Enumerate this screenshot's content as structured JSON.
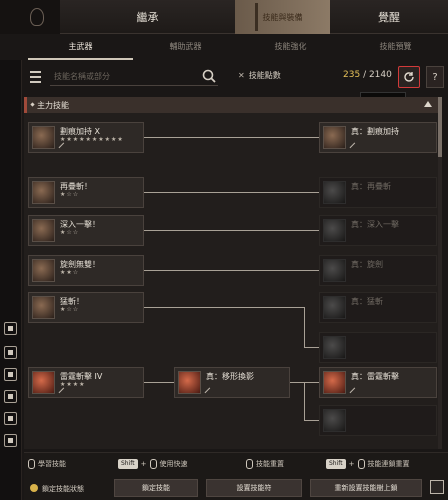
{
  "main_tabs": [
    "繼承",
    "",
    "覺醒"
  ],
  "banner_text": "技能與裝備",
  "sub_tabs": [
    "主武器",
    "輔助武器",
    "技能強化",
    "技能預覽"
  ],
  "search": {
    "placeholder": "技能名稱或部分"
  },
  "skill_points": {
    "label": "技能點數",
    "current": "235",
    "total": "/ 2140"
  },
  "reset_tooltip": "技能重置",
  "help_label": "?",
  "section": {
    "label": "主力技能"
  },
  "nodes": [
    {
      "name": "劃痕加持 X",
      "stars": "★★★★★★★★★★",
      "state": "active"
    },
    {
      "name": "真：劃痕加持",
      "stars": "",
      "state": "active"
    },
    {
      "name": "再疊斬！",
      "stars": "★☆☆",
      "state": "active"
    },
    {
      "name": "真：再疊斬",
      "stars": "",
      "state": "locked"
    },
    {
      "name": "深入一擊！",
      "stars": "★☆☆",
      "state": "active"
    },
    {
      "name": "真：深入一擊",
      "stars": "",
      "state": "locked"
    },
    {
      "name": "旋劍無雙！",
      "stars": "★★☆",
      "state": "active"
    },
    {
      "name": "真：旋劍",
      "stars": "",
      "state": "locked"
    },
    {
      "name": "猛斬！",
      "stars": "★☆☆",
      "state": "active"
    },
    {
      "name": "真：猛斬",
      "stars": "",
      "state": "locked"
    },
    {
      "name": "",
      "stars": "",
      "state": "locked"
    },
    {
      "name": "雷霆斬擊 IV",
      "stars": "★★★★",
      "state": "active"
    },
    {
      "name": "真：移形換影",
      "stars": "",
      "state": "active"
    },
    {
      "name": "真：雷霆斬擊",
      "stars": "",
      "state": "active"
    },
    {
      "name": "",
      "stars": "",
      "state": "locked"
    }
  ],
  "legend": {
    "learn": "學習技能",
    "shift1": "Shift",
    "use_quick": "使用快速",
    "skill_reset": "技能重置",
    "shift2": "Shift",
    "skill_cascade_reset": "技能連鎖重置"
  },
  "bottom_buttons": {
    "toggle": "鎖定技能狀態",
    "b1": "鎖定技能",
    "b2": "設置技能符",
    "b3": "重新設置技能樹上鎖"
  }
}
